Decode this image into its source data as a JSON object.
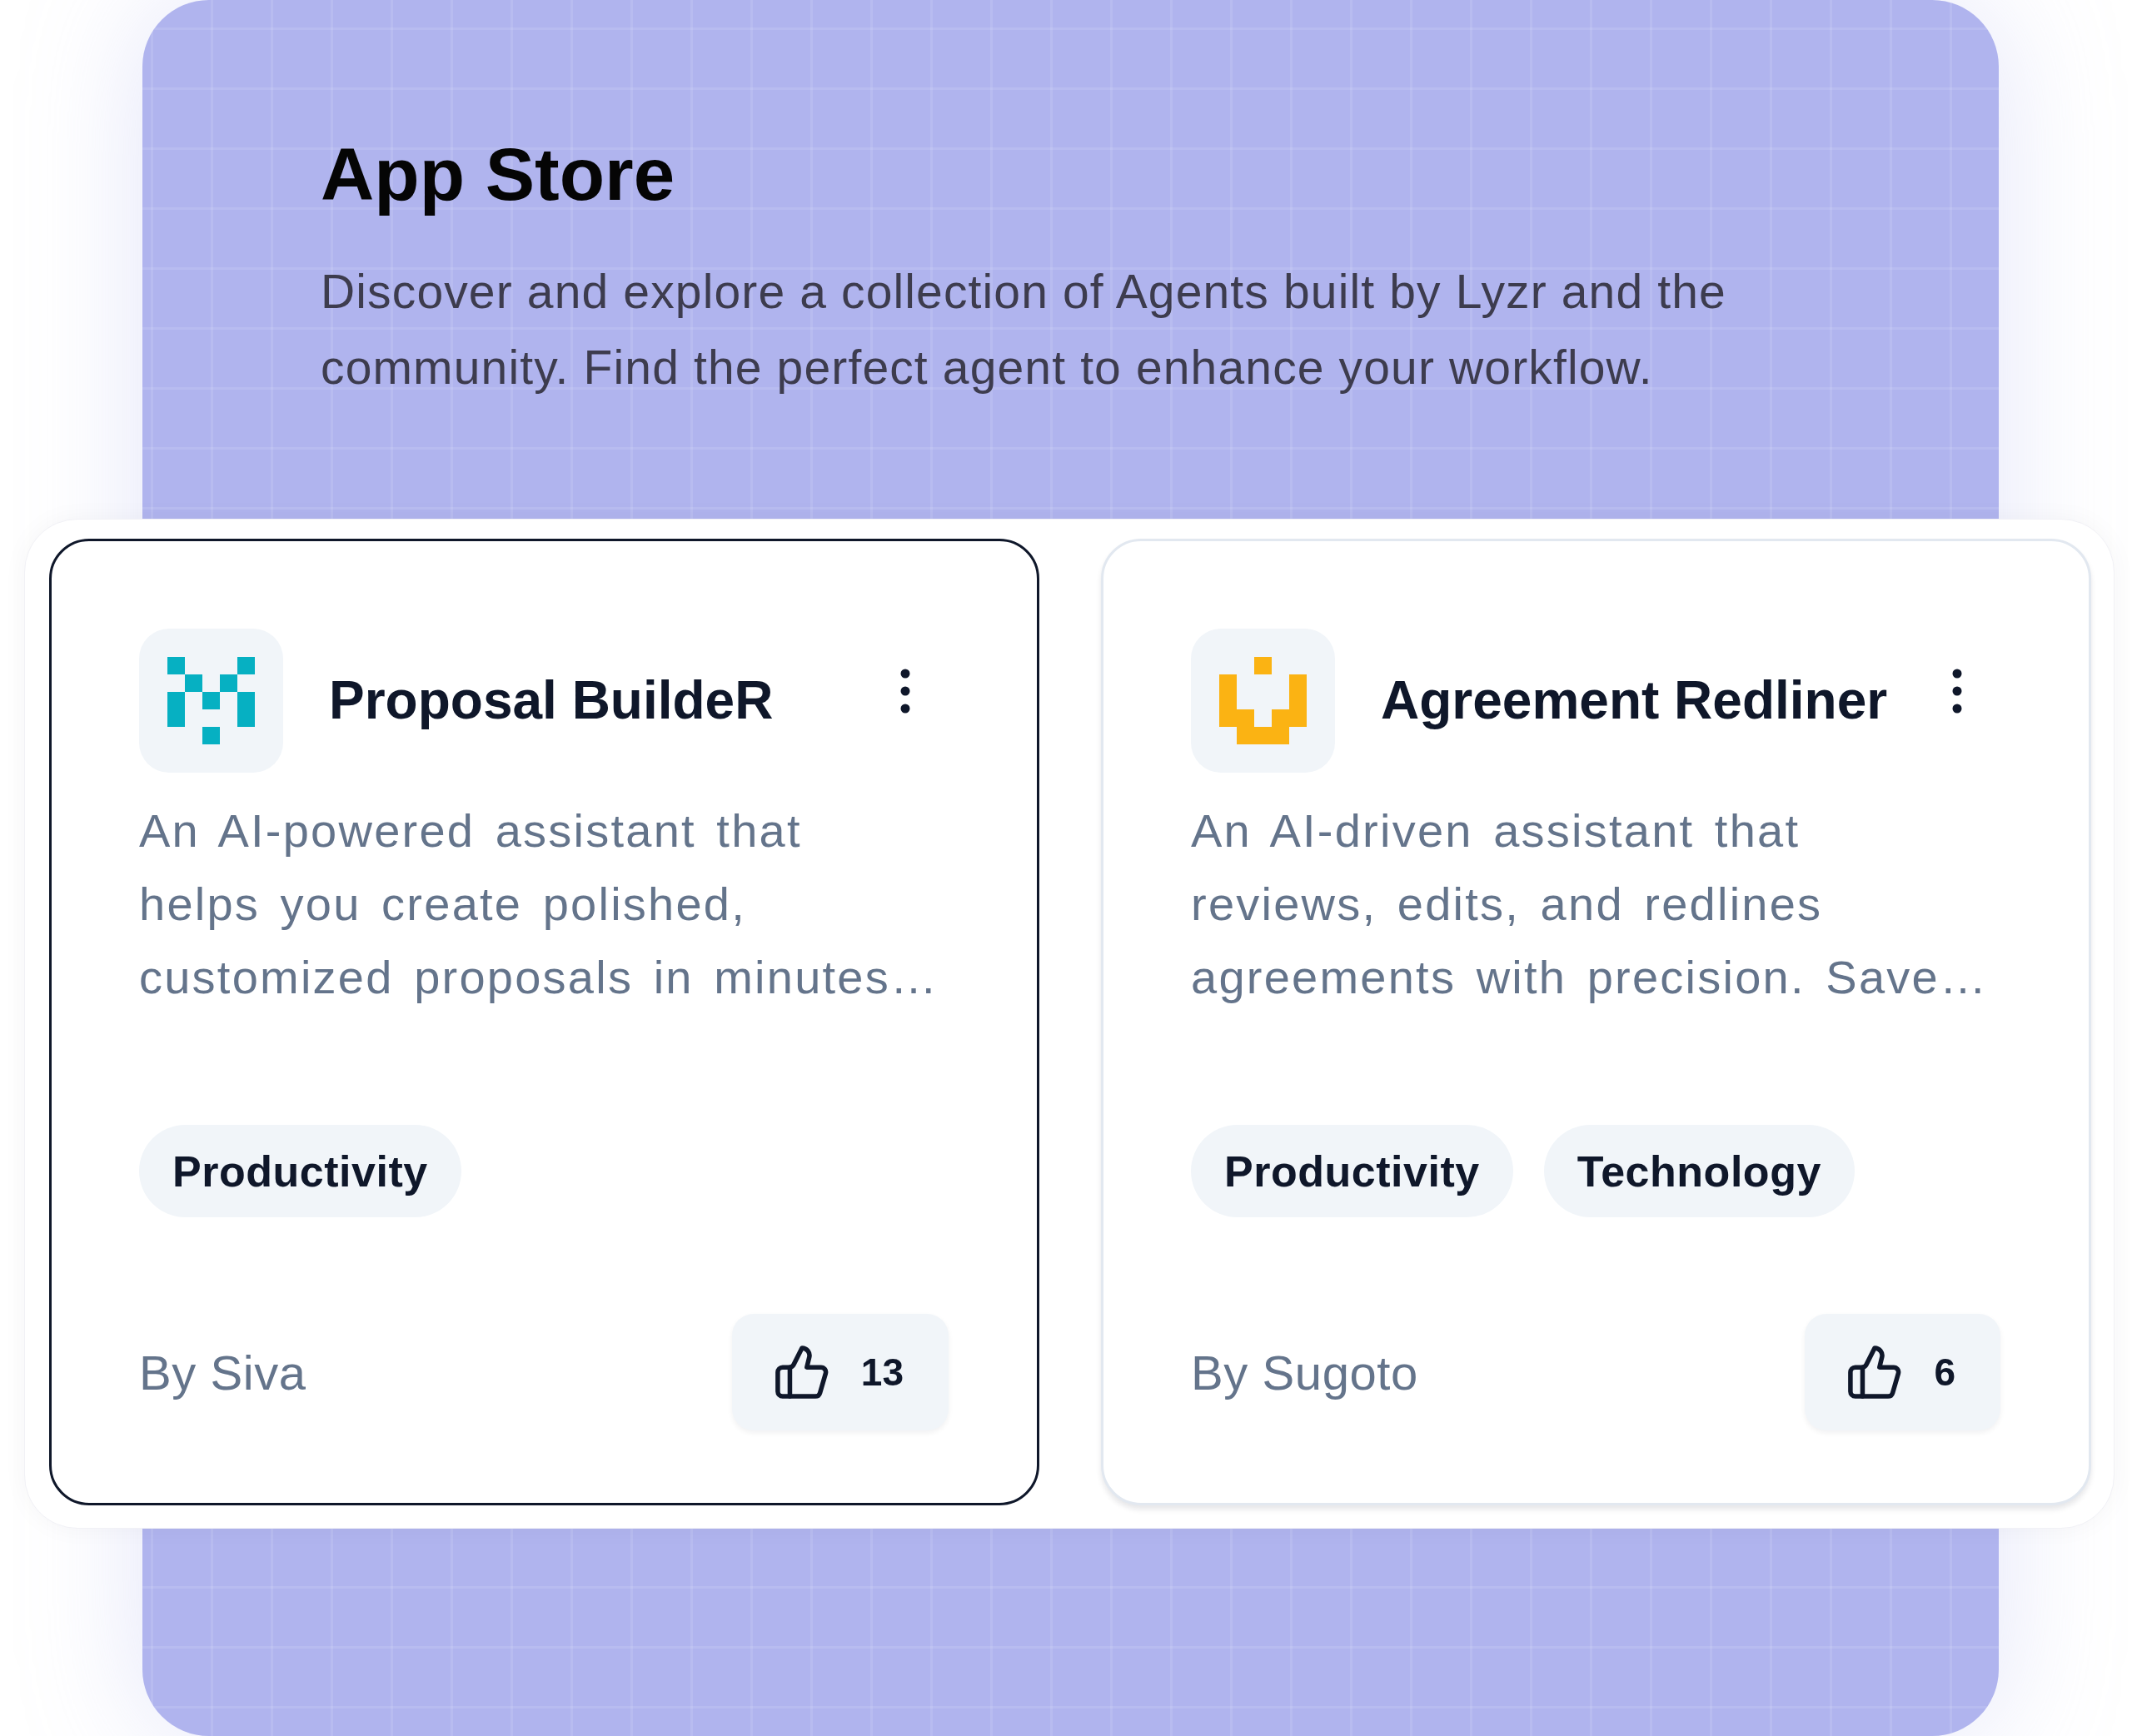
{
  "header": {
    "title": "App Store",
    "description": "Discover and explore a collection of Agents built by Lyzr and the community. Find the perfect agent to enhance your workflow."
  },
  "cards": [
    {
      "name": "Proposal BuildeR",
      "selected": true,
      "logo": {
        "kind": "m",
        "color": "#06b0c2"
      },
      "description": "An AI-powered assistant that helps you create polished, customized proposals in minutes…",
      "tags": [
        "Productivity"
      ],
      "author": "By Siva",
      "likes": "13"
    },
    {
      "name": "Agreement Redliner",
      "selected": false,
      "logo": {
        "kind": "u",
        "color": "#fbb313"
      },
      "description": "An AI-driven assistant that reviews, edits, and redlines agreements with precision. Save…",
      "tags": [
        "Productivity",
        "Technology"
      ],
      "author": "By Sugoto",
      "likes": "6"
    }
  ]
}
